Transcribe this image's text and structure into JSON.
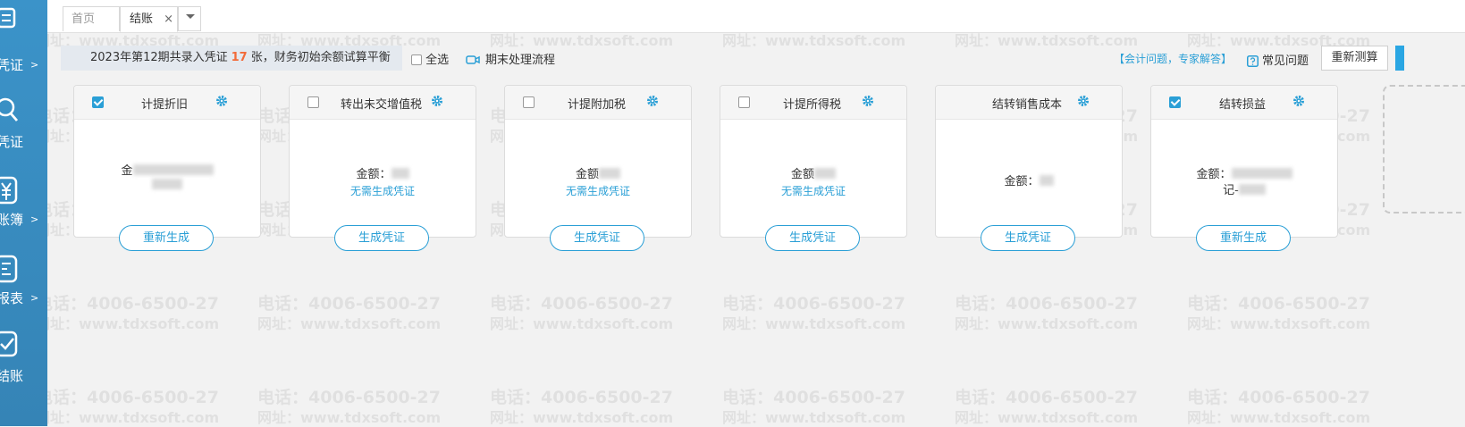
{
  "sidebar": {
    "items": [
      {
        "label": "凭证",
        "arrow": ">",
        "icon": "voucher-icon"
      },
      {
        "label": "凭证",
        "arrow": "",
        "icon": "search-icon"
      },
      {
        "label": "账簿",
        "arrow": ">",
        "icon": "yen-icon"
      },
      {
        "label": "报表",
        "arrow": ">",
        "icon": "report-icon"
      },
      {
        "label": "结账",
        "arrow": "",
        "icon": "checkout-icon"
      }
    ]
  },
  "tabs": {
    "home": "首页",
    "active": "结账",
    "close": "×"
  },
  "toolbar": {
    "notice_prefix": "2023年第12期共录入凭证",
    "notice_count": "17",
    "notice_suffix": "张，财务初始余额试算平衡",
    "select_all": "全选",
    "flow": "期末处理流程",
    "expert": "【会计问题，专家解答】",
    "faq": "常见问题",
    "recalc": "重新测算"
  },
  "cards": [
    {
      "title": "计提折旧",
      "checked": true,
      "amount_label": "金",
      "note": "",
      "button": "重新生成"
    },
    {
      "title": "转出未交增值税",
      "checked": false,
      "amount_label": "金额：",
      "note": "无需生成凭证",
      "button": "生成凭证"
    },
    {
      "title": "计提附加税",
      "checked": false,
      "amount_label": "金额",
      "note": "无需生成凭证",
      "button": "生成凭证"
    },
    {
      "title": "计提所得税",
      "checked": false,
      "amount_label": "金额",
      "note": "无需生成凭证",
      "button": "生成凭证"
    },
    {
      "title": "结转销售成本",
      "checked": null,
      "amount_label": "金额：",
      "note": "",
      "button": "生成凭证"
    },
    {
      "title": "结转损益",
      "checked": true,
      "amount_label": "金额：",
      "voucher_label": "记-",
      "note": "",
      "button": "重新生成"
    }
  ],
  "watermark": {
    "phone": "电话：4006-6500-27",
    "site": "网址：www.tdxsoft.com"
  },
  "colors": {
    "sidebar": "#3a8fc4",
    "accent": "#2a9fd6",
    "count": "#f26b3a"
  }
}
